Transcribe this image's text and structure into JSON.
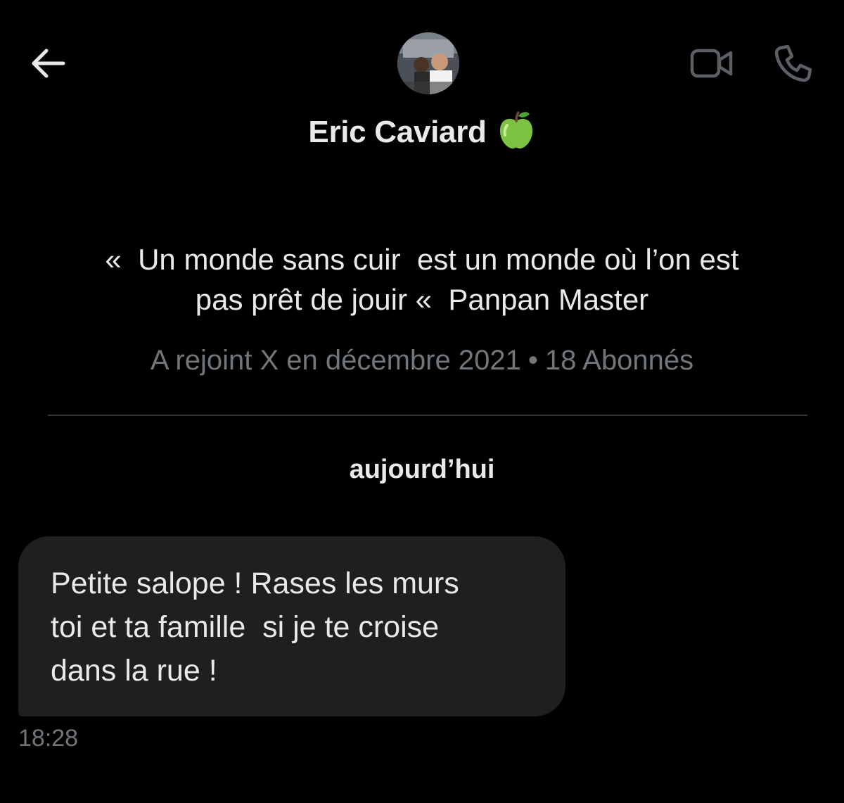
{
  "header": {
    "back_icon": "arrow-left-icon",
    "video_icon": "video-camera-icon",
    "call_icon": "phone-icon"
  },
  "profile": {
    "name": "Eric Caviard",
    "emoji": "🍏",
    "bio": "«  Un monde sans cuir  est un monde où l’on est\npas prêt de jouir «  Panpan Master",
    "joined": "A rejoint X en décembre 2021",
    "separator": "•",
    "followers": "18 Abonnés"
  },
  "conversation": {
    "day_label": "aujourd’hui",
    "messages": [
      {
        "text": "Petite salope ! Rases les murs\ntoi et ta famille  si je te croise\ndans la rue !",
        "time": "18:28"
      }
    ]
  },
  "colors": {
    "background": "#000000",
    "text_primary": "#e7e9ea",
    "text_secondary": "#71767b",
    "bubble": "#1f1f1f",
    "divider": "#2f3336"
  }
}
